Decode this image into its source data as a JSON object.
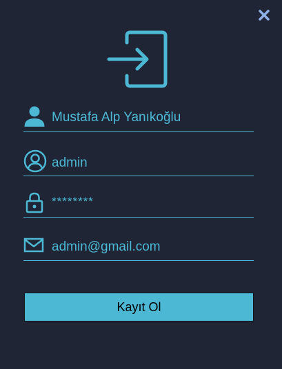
{
  "window": {
    "close_icon": "close-icon"
  },
  "logo": {
    "icon": "login-icon"
  },
  "form": {
    "name": {
      "icon": "user-icon",
      "value": "Mustafa Alp Yanıkoğlu"
    },
    "username": {
      "icon": "user-circle-icon",
      "value": "admin"
    },
    "password": {
      "icon": "lock-icon",
      "value": "********"
    },
    "email": {
      "icon": "mail-icon",
      "value": "admin@gmail.com"
    },
    "submit_label": "Kayıt Ol"
  },
  "colors": {
    "background": "#1f2535",
    "accent": "#4cb8d4",
    "close_icon": "#8fb2e6",
    "button_text": "#000000"
  }
}
